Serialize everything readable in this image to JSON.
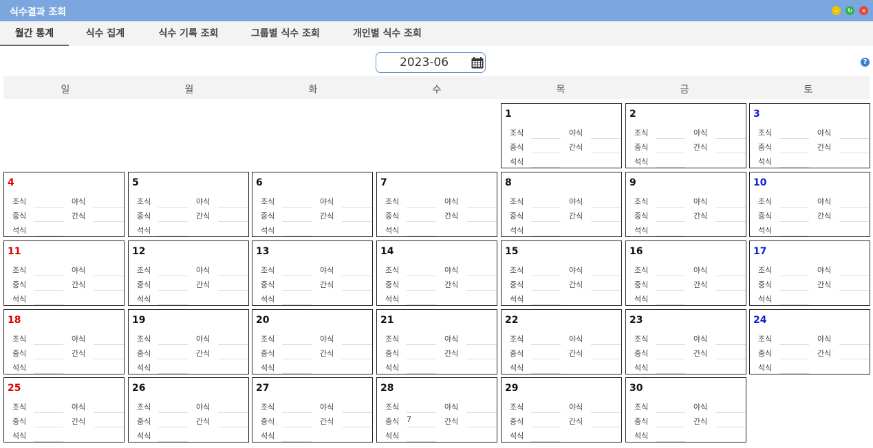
{
  "window": {
    "title": "식수결과 조회",
    "controls": [
      "minimize-icon",
      "restore-icon",
      "close-icon"
    ],
    "control_colors": [
      "#f2c200",
      "#2fb54a",
      "#e8443a"
    ]
  },
  "tabs": [
    {
      "label": "월간 통계",
      "active": true
    },
    {
      "label": "식수 집계",
      "active": false
    },
    {
      "label": "식수 기록 조회",
      "active": false
    },
    {
      "label": "그룹별 식수 조회",
      "active": false
    },
    {
      "label": "개인별 식수 조회",
      "active": false
    }
  ],
  "month_picker": {
    "value": "2023-06",
    "icon": "calendar-icon"
  },
  "help": {
    "icon": "help-icon",
    "glyph": "?"
  },
  "weekdays": [
    "일",
    "월",
    "화",
    "수",
    "목",
    "금",
    "토"
  ],
  "meal_labels": {
    "breakfast": "조식",
    "lunch": "중식",
    "dinner": "석식",
    "night": "야식",
    "snack": "간식"
  },
  "calendar": {
    "first_weekday_index": 4,
    "colors": {
      "sunday": "#e00000",
      "saturday": "#1020d0"
    },
    "days": [
      {
        "day": "1"
      },
      {
        "day": "2"
      },
      {
        "day": "3"
      },
      {
        "day": "4"
      },
      {
        "day": "5"
      },
      {
        "day": "6"
      },
      {
        "day": "7"
      },
      {
        "day": "8"
      },
      {
        "day": "9"
      },
      {
        "day": "10"
      },
      {
        "day": "11"
      },
      {
        "day": "12"
      },
      {
        "day": "13"
      },
      {
        "day": "14"
      },
      {
        "day": "15"
      },
      {
        "day": "16"
      },
      {
        "day": "17"
      },
      {
        "day": "18"
      },
      {
        "day": "19"
      },
      {
        "day": "20"
      },
      {
        "day": "21"
      },
      {
        "day": "22"
      },
      {
        "day": "23"
      },
      {
        "day": "24"
      },
      {
        "day": "25"
      },
      {
        "day": "26"
      },
      {
        "day": "27"
      },
      {
        "day": "28",
        "lunch": "7"
      },
      {
        "day": "29"
      },
      {
        "day": "30"
      }
    ]
  }
}
